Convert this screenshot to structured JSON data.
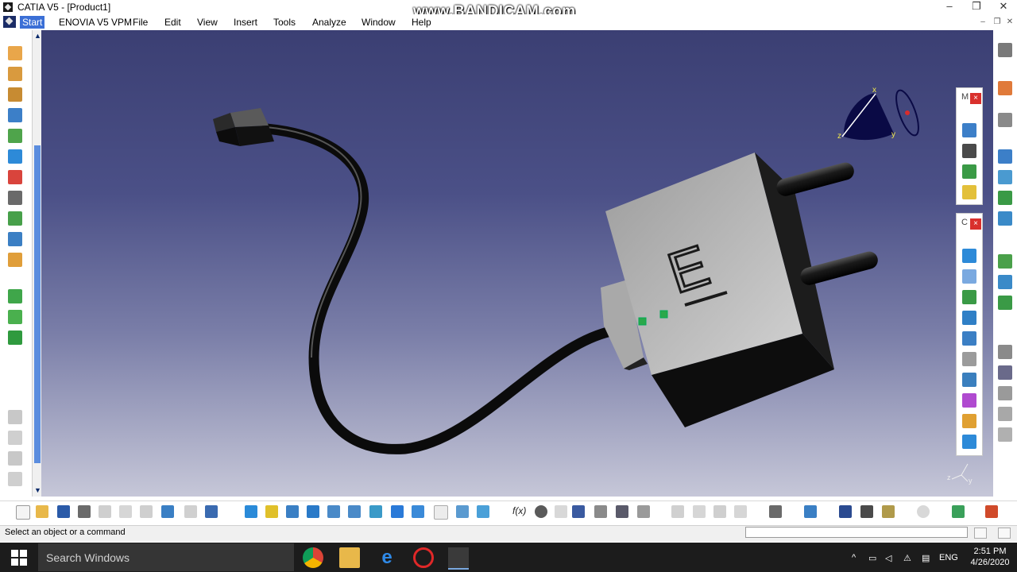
{
  "window": {
    "title": "CATIA V5 - [Product1]",
    "watermark": "www.BANDICAM.com"
  },
  "menu": {
    "items": [
      {
        "label": "Start",
        "active": true
      },
      {
        "label": "ENOVIA V5 VPM"
      },
      {
        "label": "File"
      },
      {
        "label": "Edit"
      },
      {
        "label": "View"
      },
      {
        "label": "Insert"
      },
      {
        "label": "Tools"
      },
      {
        "label": "Analyze"
      },
      {
        "label": "Window"
      },
      {
        "label": "Help"
      }
    ]
  },
  "model": {
    "plug_letter": "E"
  },
  "compass": {
    "x_label": "x",
    "y_label": "y",
    "z_label": "z"
  },
  "triad": {
    "z": "z",
    "y": "y"
  },
  "panels": {
    "panel1_label": "M",
    "panel2_label": "C",
    "close_glyph": "×"
  },
  "status": {
    "message": "Select an object or a command",
    "command_value": ""
  },
  "taskbar": {
    "search_placeholder": "Search Windows",
    "language": "ENG",
    "time": "2:51 PM",
    "date": "4/26/2020"
  },
  "icons": {
    "formula": "f(x)"
  },
  "colors": {
    "accent": "#3b6fd6",
    "viewport_top": "#3b3f73",
    "viewport_bottom": "#c6c7d8",
    "taskbar": "#1c1c1c"
  }
}
